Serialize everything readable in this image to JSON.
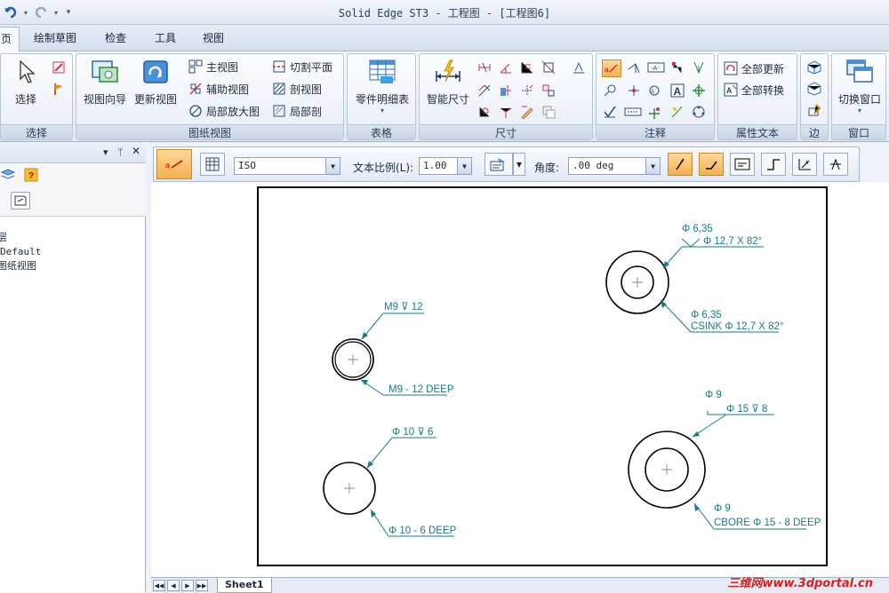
{
  "window": {
    "title": "Solid Edge ST3 - 工程图 - [工程图6]"
  },
  "tabs": [
    {
      "label": "页"
    },
    {
      "label": "绘制草图"
    },
    {
      "label": "检查"
    },
    {
      "label": "工具"
    },
    {
      "label": "视图"
    }
  ],
  "ribbon": {
    "select": {
      "label": "选择",
      "btn": "选择"
    },
    "drawing_views": {
      "label": "图纸视图",
      "view_wizard": "视图向导",
      "update_view": "更新视图",
      "principal": "主视图",
      "auxiliary": "辅助视图",
      "detail": "局部放大图",
      "cutting_plane": "切割平面",
      "section": "剖视图",
      "broken_out": "局部剖"
    },
    "tables": {
      "label": "表格",
      "parts_list": "零件明细表"
    },
    "dimension": {
      "label": "尺寸",
      "smart_dim": "智能尺寸"
    },
    "annotation": {
      "label": "注释"
    },
    "property_text": {
      "label": "属性文本",
      "update_all": "全部更新",
      "convert_all": "全部转换"
    },
    "edge": {
      "label": "边"
    },
    "window": {
      "label": "窗口",
      "switch": "切换窗口"
    }
  },
  "left_panel": {
    "tree": [
      "层",
      "Default",
      "图纸视图"
    ]
  },
  "prop_bar": {
    "style": "ISO",
    "text_scale_label": "文本比例(L):",
    "text_scale": "1.00",
    "angle_label": "角度:",
    "angle": ".00 deg"
  },
  "drawing": {
    "hole_m9_top": "M9",
    "hole_m9_depth": "12",
    "hole_m9_callout": "M9 - 12 DEEP",
    "hole_10_top_d": "10",
    "hole_10_top_depth": "6",
    "hole_10_callout": "10 - 6 DEEP",
    "csink_top_d": "6,35",
    "csink_top_spec": "12,7 X 82°",
    "csink_bot_d": "6,35",
    "csink_bot_spec": "CSINK",
    "csink_bot_spec2": "12,7 X 82°",
    "cbore_top_d": "9",
    "cbore_top_spec": "15",
    "cbore_top_depth": "8",
    "cbore_bot_d": "9",
    "cbore_bot_spec": "CBORE",
    "cbore_bot_spec2": "15 - 8 DEEP"
  },
  "status": {
    "sheet_tab": "Sheet1",
    "watermark": "三维网www.3dportal.cn"
  }
}
